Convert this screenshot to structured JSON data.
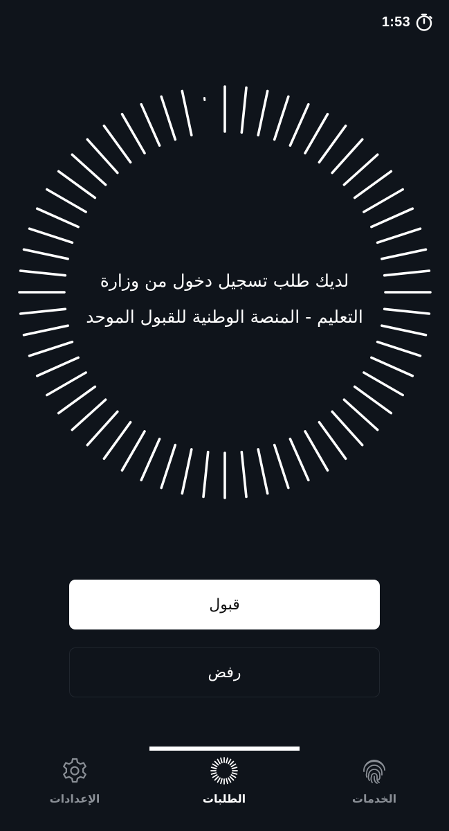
{
  "status_bar": {
    "time": "1:53",
    "icon": "timer-icon"
  },
  "request": {
    "message": "لديك طلب تسجيل دخول من  وزارة\nالتعليم - المنصة الوطنية للقبول الموحد",
    "ring_icon": "loading-spinner-ring"
  },
  "actions": {
    "accept_label": "قبول",
    "reject_label": "رفض"
  },
  "tabs": [
    {
      "label": "الإعدادات",
      "icon": "gear-icon",
      "active": false
    },
    {
      "label": "الطلبات",
      "icon": "spinner-icon",
      "active": true
    },
    {
      "label": "الخدمات",
      "icon": "fingerprint-icon",
      "active": false
    }
  ],
  "colors": {
    "background": "#0f141b",
    "accent": "#ffffff",
    "inactive_tab": "#8a8f96"
  }
}
